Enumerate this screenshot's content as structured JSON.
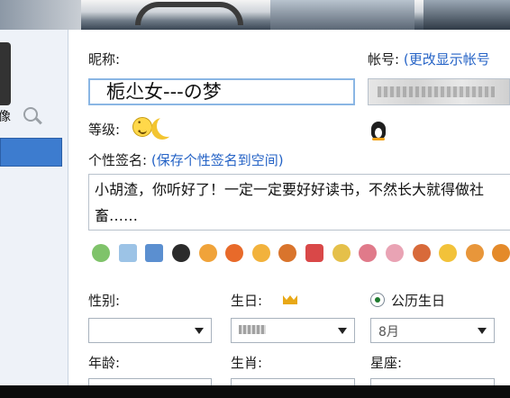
{
  "nickname": {
    "label": "昵称:",
    "value": "栀尐女---の梦"
  },
  "account": {
    "label": "帐号:",
    "change_link": "(更改显示帐号"
  },
  "level": {
    "label": "等级:"
  },
  "signature": {
    "label": "个性签名:",
    "save_link": "(保存个性签名到空间)",
    "text": "小胡渣，你听好了！一定一定要好好读书，不然长大就得做社畜……"
  },
  "sidebar": {
    "label": "像"
  },
  "fields": {
    "gender_label": "性别:",
    "birthday_label": "生日:",
    "calendar_option": "公历生日",
    "month_value": "8月",
    "age_label": "年龄:",
    "zodiac_animal_label": "生肖:",
    "constellation_label": "星座:"
  },
  "icons": [
    "smiley-level-icon",
    "moon-level-icon",
    "qq-penguin-icon",
    "crown-icon"
  ],
  "colors": {
    "link": "#2563c6",
    "selection": "#3d7ccf",
    "input_focus_border": "#8ab6e4"
  }
}
